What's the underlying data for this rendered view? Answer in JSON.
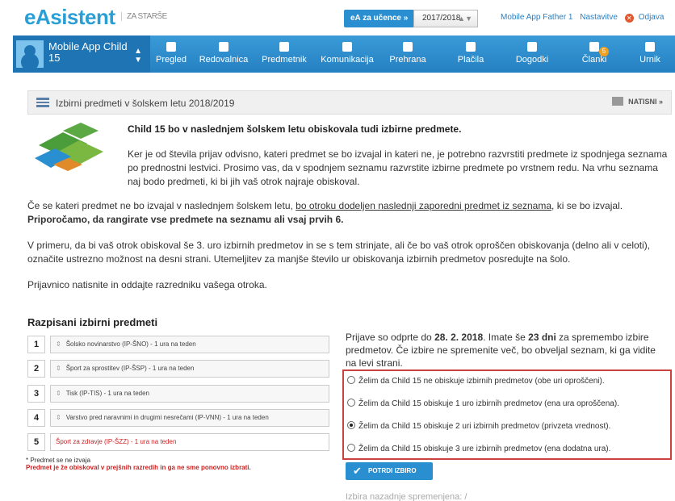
{
  "header": {
    "logo": "eAsistent",
    "logo_sub": "ZA STARŠE",
    "students_button": "eA za učence »",
    "year": "2017/2018",
    "user": "Mobile App Father 1",
    "settings": "Nastavitve",
    "logout": "Odjava"
  },
  "nav": {
    "child_name": "Mobile App Child 15",
    "items": [
      {
        "label": "Pregled"
      },
      {
        "label": "Redovalnica"
      },
      {
        "label": "Predmetnik"
      },
      {
        "label": "Komunikacija"
      },
      {
        "label": "Prehrana"
      },
      {
        "label": "Plačila"
      },
      {
        "label": "Dogodki"
      },
      {
        "label": "Članki",
        "badge": "5"
      },
      {
        "label": "Urnik"
      }
    ]
  },
  "panel": {
    "title": "Izbirni predmeti v šolskem letu 2018/2019",
    "print": "NATISNI »"
  },
  "intro": {
    "bold": "Child 15 bo v naslednjem šolskem letu obiskovala tudi izbirne predmete.",
    "text": "Ker je od števila prijav odvisno, kateri predmet se bo izvajal in kateri ne, je potrebno razvrstiti predmete iz spodnjega seznama po prednostni lestvici. Prosimo vas, da v spodnjem seznamu razvrstite izbirne predmete po vrstnem redu. Na vrhu seznama naj bodo predmeti, ki bi jih vaš otrok najraje obiskoval."
  },
  "para1": {
    "a": "Če se kateri predmet ne bo izvajal v naslednjem šolskem letu, ",
    "u": "bo otroku dodeljen naslednji zaporedni predmet iz seznama",
    "b": ", ki se bo izvajal.",
    "bold": "Priporočamo, da rangirate vse predmete na seznamu ali vsaj prvih 6."
  },
  "para2": "V primeru, da bi vaš otrok obiskoval še 3. uro izbirnih predmetov in se s tem strinjate, ali če bo vaš otrok oproščen obiskovanja (delno ali v celoti), označite ustrezno možnost na desni strani. Utemeljitev za manjše število ur obiskovanja izbirnih predmetov posredujte na šolo.",
  "para3": "Prijavnico natisnite in oddajte razredniku vašega otroka.",
  "subjects_title": "Razpisani izbirni predmeti",
  "subjects": [
    {
      "num": "1",
      "label": "Šolsko novinarstvo (IP-ŠNO) - 1 ura na teden"
    },
    {
      "num": "2",
      "label": "Šport za sprostitev (IP-ŠSP) - 1 ura na teden"
    },
    {
      "num": "3",
      "label": "Tisk (IP-TIS) - 1 ura na teden"
    },
    {
      "num": "4",
      "label": "Varstvo pred naravnimi in drugimi nesrečami (IP-VNN) - 1 ura na teden"
    },
    {
      "num": "5",
      "label": "Šport za zdravje (IP-ŠZZ) - 1 ura na teden"
    }
  ],
  "note": {
    "line1": "* Predmet se ne izvaja",
    "line2": "Predmet je že obiskoval v prejšnih razredih in ga ne sme ponovno izbrati."
  },
  "deadline": {
    "a": "Prijave so odprte do ",
    "date": "28. 2. 2018",
    "b": ". Imate še ",
    "days": "23 dni",
    "c": " za spremembo izbire predmetov. Če izbire ne spremenite več, bo obveljal seznam, ki ga vidite na levi strani."
  },
  "options": [
    {
      "label": "Želim da Child 15 ne obiskuje izbirnih predmetov (obe uri oproščeni).",
      "checked": false
    },
    {
      "label": "Želim da Child 15 obiskuje 1 uro izbirnih predmetov (ena ura oproščena).",
      "checked": false
    },
    {
      "label": "Želim da Child 15 obiskuje 2 uri izbirnih predmetov (privzeta vrednost).",
      "checked": true
    },
    {
      "label": "Želim da Child 15 obiskuje 3 ure izbirnih predmetov (ena dodatna ura).",
      "checked": false
    }
  ],
  "confirm_button": "POTRDI IZBIRO",
  "last_changed": "Izbira nazadnje spremenjena: /"
}
